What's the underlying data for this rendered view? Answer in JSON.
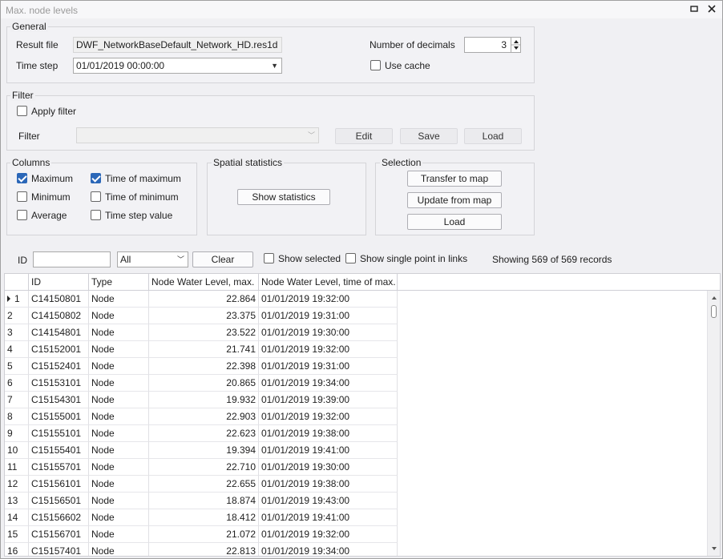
{
  "window": {
    "title": "Max. node levels"
  },
  "general": {
    "label": "General",
    "result_file_label": "Result file",
    "result_file_value": "DWF_NetworkBaseDefault_Network_HD.res1d",
    "time_step_label": "Time step",
    "time_step_value": "01/01/2019 00:00:00",
    "decimals_label": "Number of decimals",
    "decimals_value": "3",
    "use_cache_label": "Use cache"
  },
  "filter": {
    "label": "Filter",
    "apply_label": "Apply filter",
    "filter_label": "Filter",
    "filter_value": "",
    "edit_label": "Edit",
    "save_label": "Save",
    "load_label": "Load"
  },
  "columns": {
    "label": "Columns",
    "maximum": "Maximum",
    "minimum": "Minimum",
    "average": "Average",
    "time_of_maximum": "Time of maximum",
    "time_of_minimum": "Time of minimum",
    "time_step_value": "Time step value"
  },
  "spatial": {
    "label": "Spatial statistics",
    "show_label": "Show statistics"
  },
  "selection": {
    "label": "Selection",
    "transfer_label": "Transfer to map",
    "update_label": "Update from map",
    "load_label": "Load"
  },
  "toolbar": {
    "id_label": "ID",
    "id_value": "",
    "type_value": "All",
    "clear_label": "Clear",
    "show_selected_label": "Show selected",
    "show_single_label": "Show single point in links",
    "records_text": "Showing 569 of 569 records"
  },
  "grid": {
    "headers": [
      "ID",
      "Type",
      "Node Water Level, max.",
      "Node Water Level, time of max."
    ],
    "rows": [
      [
        "1",
        "C14150801",
        "Node",
        "22.864",
        "01/01/2019 19:32:00"
      ],
      [
        "2",
        "C14150802",
        "Node",
        "23.375",
        "01/01/2019 19:31:00"
      ],
      [
        "3",
        "C14154801",
        "Node",
        "23.522",
        "01/01/2019 19:30:00"
      ],
      [
        "4",
        "C15152001",
        "Node",
        "21.741",
        "01/01/2019 19:32:00"
      ],
      [
        "5",
        "C15152401",
        "Node",
        "22.398",
        "01/01/2019 19:31:00"
      ],
      [
        "6",
        "C15153101",
        "Node",
        "20.865",
        "01/01/2019 19:34:00"
      ],
      [
        "7",
        "C15154301",
        "Node",
        "19.932",
        "01/01/2019 19:39:00"
      ],
      [
        "8",
        "C15155001",
        "Node",
        "22.903",
        "01/01/2019 19:32:00"
      ],
      [
        "9",
        "C15155101",
        "Node",
        "22.623",
        "01/01/2019 19:38:00"
      ],
      [
        "10",
        "C15155401",
        "Node",
        "19.394",
        "01/01/2019 19:41:00"
      ],
      [
        "11",
        "C15155701",
        "Node",
        "22.710",
        "01/01/2019 19:30:00"
      ],
      [
        "12",
        "C15156101",
        "Node",
        "22.655",
        "01/01/2019 19:38:00"
      ],
      [
        "13",
        "C15156501",
        "Node",
        "18.874",
        "01/01/2019 19:43:00"
      ],
      [
        "14",
        "C15156602",
        "Node",
        "18.412",
        "01/01/2019 19:41:00"
      ],
      [
        "15",
        "C15156701",
        "Node",
        "21.072",
        "01/01/2019 19:32:00"
      ],
      [
        "16",
        "C15157401",
        "Node",
        "22.813",
        "01/01/2019 19:34:00"
      ]
    ]
  }
}
